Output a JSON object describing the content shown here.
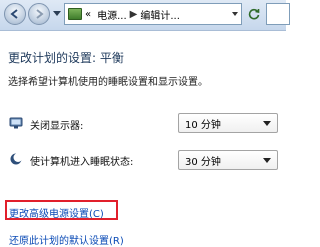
{
  "toolbar": {
    "breadcrumbs": [
      "电源...",
      "编辑计..."
    ],
    "separator": "▶",
    "leading_chevron": "«"
  },
  "page": {
    "title": "更改计划的设置: 平衡",
    "description": "选择希望计算机使用的睡眠设置和显示设置。"
  },
  "settings": {
    "display_off": {
      "label": "关闭显示器:",
      "value": "10 分钟"
    },
    "sleep": {
      "label": "使计算机进入睡眠状态:",
      "value": "30 分钟"
    }
  },
  "links": {
    "advanced": "更改高级电源设置(C)",
    "restore": "还原此计划的默认设置(R)"
  },
  "colors": {
    "link": "#0a4ab5",
    "title": "#1e395b",
    "highlight": "#e11f2b"
  },
  "icons": {
    "back": "back-arrow-icon",
    "forward": "forward-arrow-icon",
    "control_panel": "control-panel-icon",
    "refresh": "refresh-icon",
    "monitor": "monitor-icon",
    "sleep": "moon-icon"
  }
}
